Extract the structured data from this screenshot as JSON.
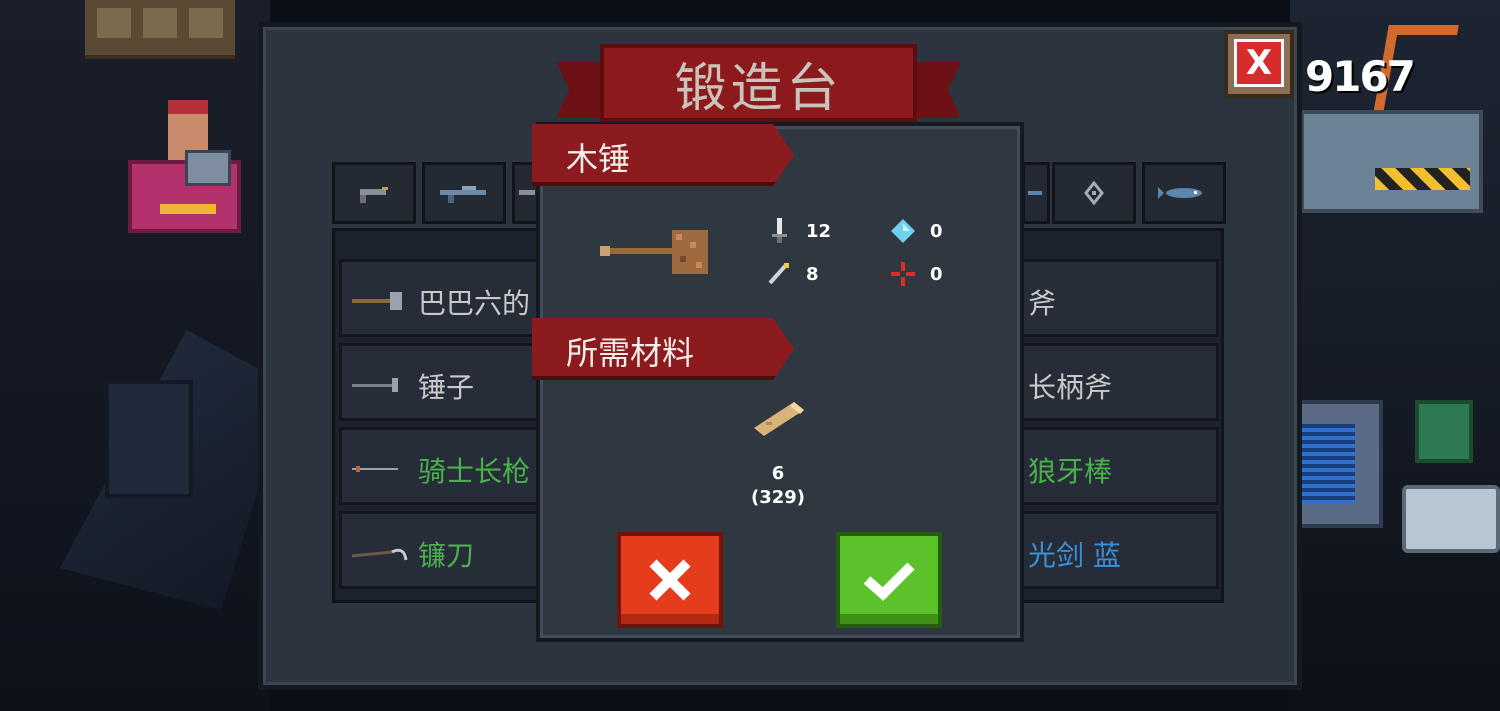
{
  "coin_count": "9167",
  "close_label": "X",
  "forge": {
    "title": "锻造台",
    "tabs": [
      "pistol",
      "rifle",
      "tab3",
      "tab8",
      "shuriken",
      "fish"
    ],
    "rows": [
      {
        "left": "巴巴六的",
        "right": "斧",
        "left_color": "#c9c9c9",
        "right_color": "#c9c9c9"
      },
      {
        "left": "锤子",
        "right": "长柄斧",
        "left_color": "#c9c9c9",
        "right_color": "#c9c9c9"
      },
      {
        "left": "骑士长枪",
        "right": "狼牙棒",
        "left_color": "#49b04b",
        "right_color": "#49b04b"
      },
      {
        "left": "镰刀",
        "right": "光剑 蓝",
        "left_color": "#49b04b",
        "right_color": "#3b8fd8"
      }
    ]
  },
  "modal": {
    "weapon_name": "木锤",
    "stats": {
      "damage": "12",
      "crit": "0",
      "energy": "8",
      "accuracy": "0"
    },
    "materials_title": "所需材料",
    "material": {
      "required": "6",
      "owned": "(329)"
    },
    "colors": {
      "cancel": "#e43c1c",
      "confirm": "#5cc22a",
      "banner": "#8b1b1f"
    }
  }
}
